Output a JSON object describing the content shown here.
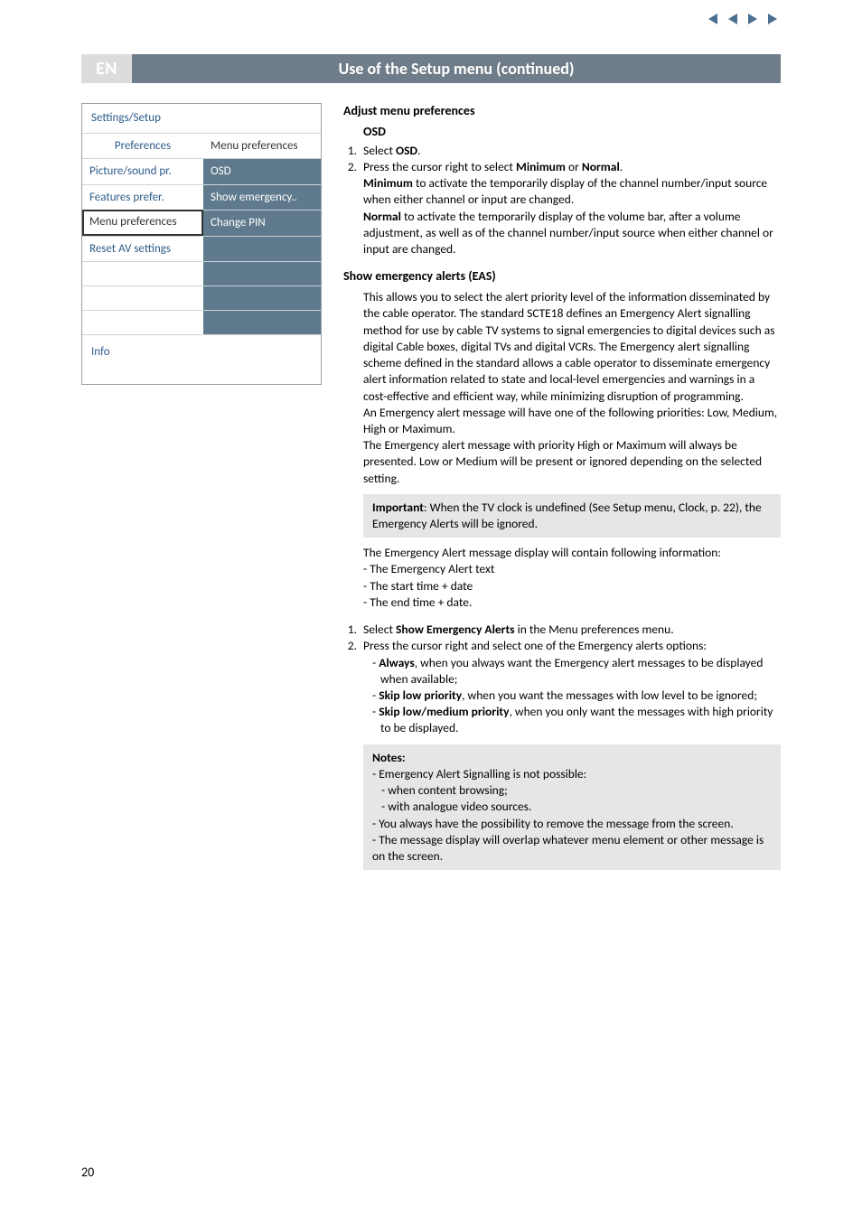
{
  "nav": {
    "first": "⏮",
    "prev": "◀",
    "next": "▶",
    "last": "⏭"
  },
  "lang": "EN",
  "title": "Use of the Setup menu   (continued)",
  "menu": {
    "title": "Settings/Setup",
    "left_head": "Preferences",
    "right_head": "Menu preferences",
    "rows": {
      "r1l": "Picture/sound pr.",
      "r1r": "OSD",
      "r2l": "Features prefer.",
      "r2r": "Show emergency..",
      "r3l": "Menu preferences",
      "r3r": "Change PIN",
      "r4l": "Reset AV settings",
      "r4r": "",
      "r5l": "",
      "r5r": "",
      "r6l": "",
      "r6r": "",
      "r7l": "",
      "r7r": ""
    },
    "info": "Info"
  },
  "section": {
    "adjust": "Adjust menu preferences",
    "osd": "OSD",
    "osd_step1_a": "Select ",
    "osd_step1_b": "OSD",
    "osd_step1_c": ".",
    "osd_step2_a": "Press the cursor right to select ",
    "osd_step2_b": "Minimum",
    "osd_step2_c": " or ",
    "osd_step2_d": "Normal",
    "osd_step2_e": ".",
    "osd_min_label": "Minimum",
    "osd_min_text": " to activate the temporarily display of the channel number/input source when either channel or input are changed.",
    "osd_norm_label": "Normal",
    "osd_norm_text": " to activate the temporarily display of the volume bar, after a volume adjustment, as well as of the channel number/input source when either channel or input are changed.",
    "eas_head": "Show emergency alerts (EAS)",
    "eas_p1": "This allows you to select the alert priority level of the information disseminated by the cable operator. The standard SCTE18 defines an Emergency Alert signalling method for use by cable TV systems to signal emergencies to digital devices such as digital Cable boxes, digital TVs and digital VCRs.",
    "eas_p2": "The Emergency alert signalling scheme defined in the standard allows a cable operator to disseminate emergency alert information related to state and local-level emergencies and warnings in a cost-effective and efficient way, while minimizing disruption of programming.",
    "eas_p3": "An Emergency alert message will have one of the following priorities: Low, Medium, High or Maximum.",
    "eas_p4": "The Emergency alert message with priority High or Maximum will always be presented. Low or Medium will be present or ignored depending on the selected setting.",
    "important_label": "Important",
    "important_text": ": When the TV clock is undefined (See Setup menu, Clock, p. 22), the Emergency Alerts will be ignored.",
    "eas_info_intro": "The Emergency Alert message display will contain following information:",
    "eas_info_1": "The Emergency Alert text",
    "eas_info_2": "The start time + date",
    "eas_info_3": "The end time + date.",
    "eas_step1_a": "Select ",
    "eas_step1_b": "Show Emergency Alerts",
    "eas_step1_c": " in the Menu preferences menu.",
    "eas_step2": "Press the cursor right and select one of the Emergency alerts options:",
    "opt_always_b": "Always",
    "opt_always_t": ", when you always want the Emergency alert messages to be displayed when available;",
    "opt_low_b": "Skip low priority",
    "opt_low_t": ", when you want the messages with low level to be ignored;",
    "opt_lowmed_b": "Skip low/medium priority",
    "opt_lowmed_t": ", when you only want the messages with high priority to be displayed.",
    "notes_head": "Notes:",
    "note1": "Emergency Alert Signalling is not possible:",
    "note1a": "when content browsing;",
    "note1b": "with analogue video sources.",
    "note2": "You always have the possibility to remove the message from the screen.",
    "note3": "The message display will overlap whatever menu element or other message is on the screen."
  },
  "page_number": "20"
}
